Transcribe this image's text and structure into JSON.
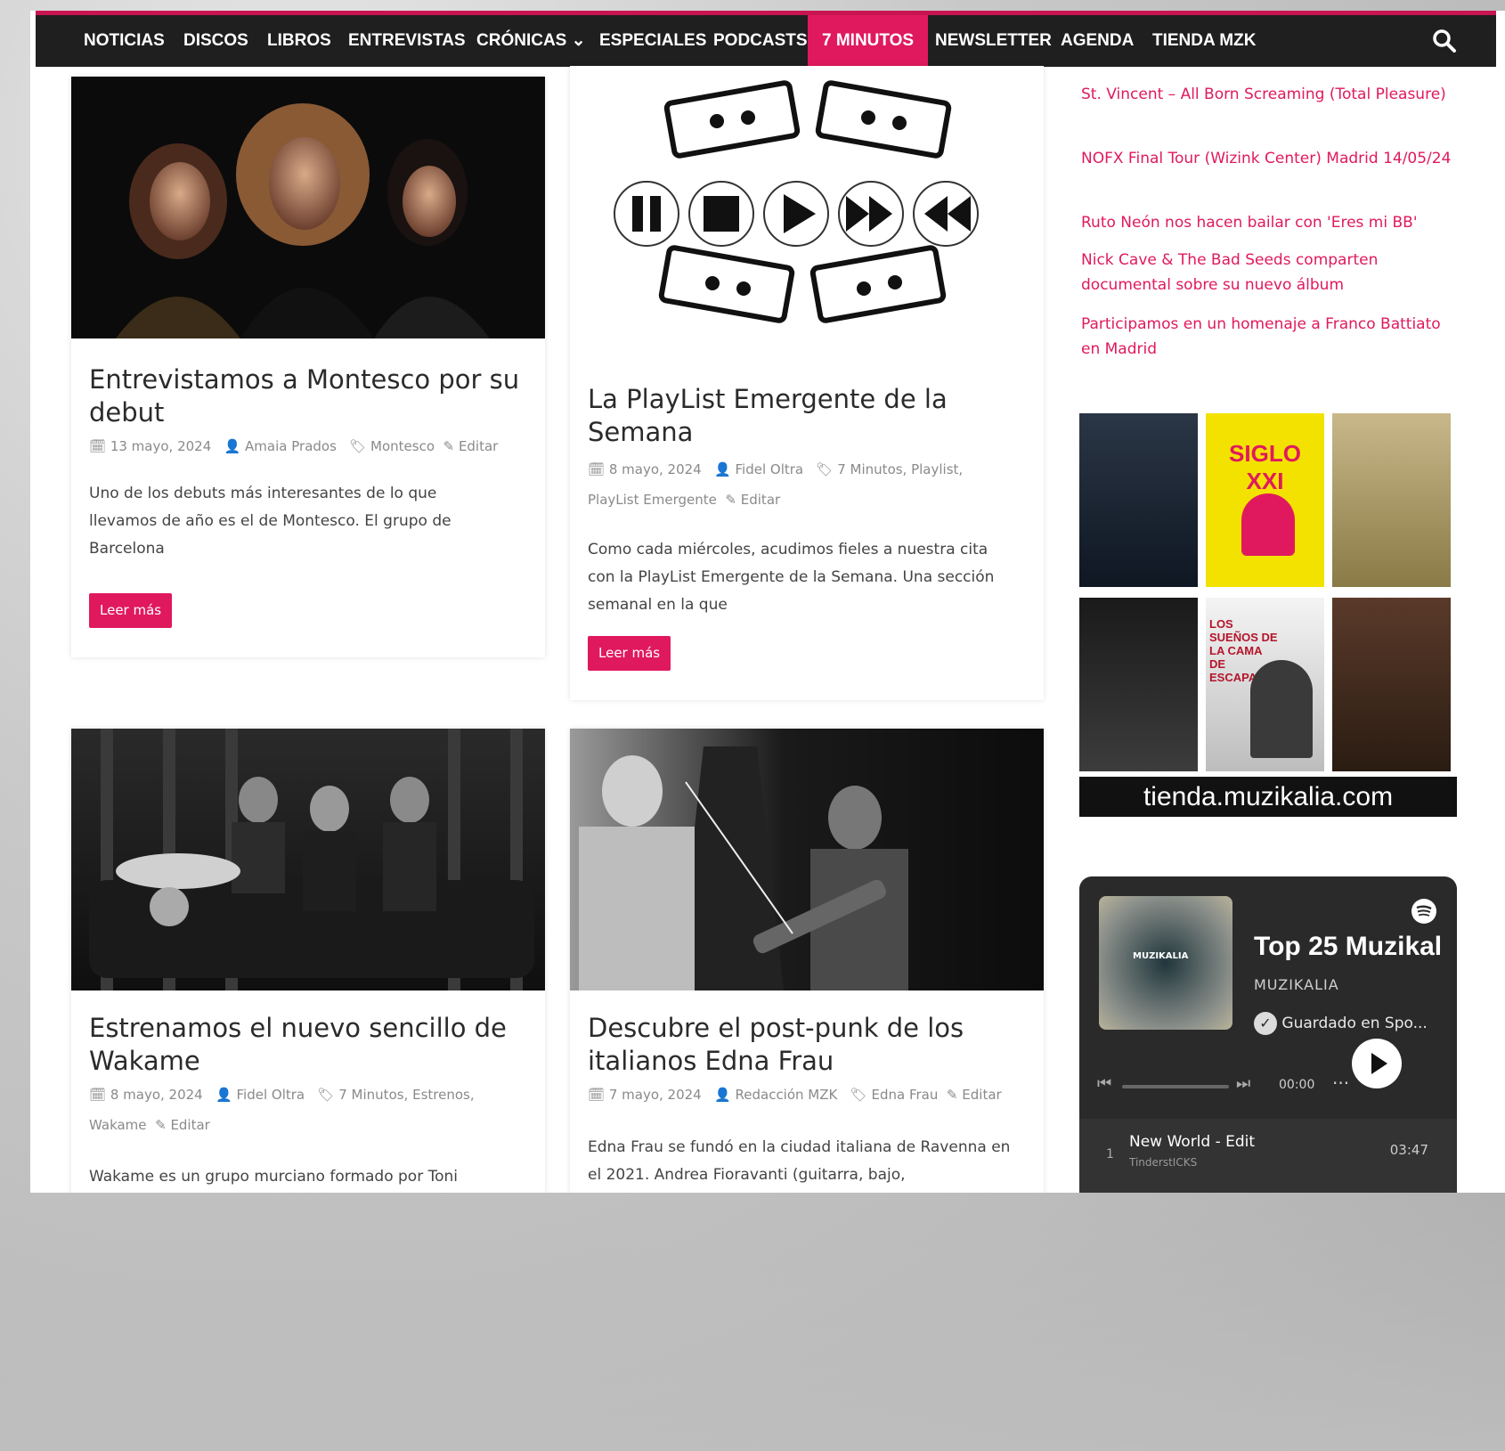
{
  "nav": {
    "items": [
      "NOTICIAS",
      "DISCOS",
      "LIBROS",
      "ENTREVISTAS",
      "CRÓNICAS ⌄",
      "ESPECIALES",
      "PODCASTS",
      "7 MINUTOS",
      "NEWSLETTER",
      "AGENDA",
      "TIENDA MZK"
    ],
    "active": "7 MINUTOS"
  },
  "articles": [
    {
      "title": "Entrevistamos a Montesco por su debut",
      "date": "13 mayo, 2024",
      "author": "Amaia Prados",
      "tags": "Montesco",
      "edit": "Editar",
      "excerpt": "Uno de los debuts más interesantes de lo que llevamos de año es el de Montesco. El grupo de Barcelona",
      "button": "Leer más"
    },
    {
      "title": "La PlayList Emergente de la Semana",
      "date": "8 mayo, 2024",
      "author": "Fidel Oltra",
      "tags": "7 Minutos, Playlist, PlayList Emergente",
      "edit": "Editar",
      "excerpt": "Como cada miércoles, acudimos fieles a nuestra cita con la PlayList Emergente de la Semana. Una sección semanal en la que",
      "button": "Leer más"
    },
    {
      "title": "Estrenamos el nuevo sencillo de Wakame",
      "date": "8 mayo, 2024",
      "author": "Fidel Oltra",
      "tags": "7 Minutos, Estrenos, Wakame",
      "edit": "Editar",
      "excerpt": "Wakame es un grupo murciano formado por Toni"
    },
    {
      "title": "Descubre el post-punk de los italianos Edna Frau",
      "date": "7 mayo, 2024",
      "author": "Redacción MZK",
      "tags": "Edna Frau",
      "edit": "Editar",
      "excerpt": "Edna Frau se fundó en la ciudad italiana de Ravenna en el 2021. Andrea Fioravanti (guitarra, bajo,"
    }
  ],
  "sidebar": {
    "links": [
      "St. Vincent – All Born Screaming (Total Pleasure)",
      "NOFX Final Tour (Wizink Center) Madrid 14/05/24",
      "Ruto Neón nos hacen bailar con 'Eres mi BB'",
      "Nick Cave & The Bad Seeds comparten documental sobre su nuevo álbum",
      "Participamos en un homenaje a Franco Battiato en Madrid"
    ],
    "book_titles": [
      "SIGLO XXI",
      "LOS SUEÑOS DE LA CAMA DE ESCAPAR"
    ],
    "store_url": "tienda.muzikalia.com"
  },
  "spotify": {
    "playlist_title": "Top 25 Muzikal",
    "owner": "MUZIKALIA",
    "saved": "Guardado en Spo...",
    "time": "00:00",
    "track_number": "1",
    "track_title": "New World - Edit",
    "track_artist": "TinderstICKS",
    "track_duration": "03:47",
    "cover_label": "MUZIKALIA"
  },
  "colors": {
    "accent": "#e0195e",
    "nav_bg": "#1f1f1f"
  }
}
